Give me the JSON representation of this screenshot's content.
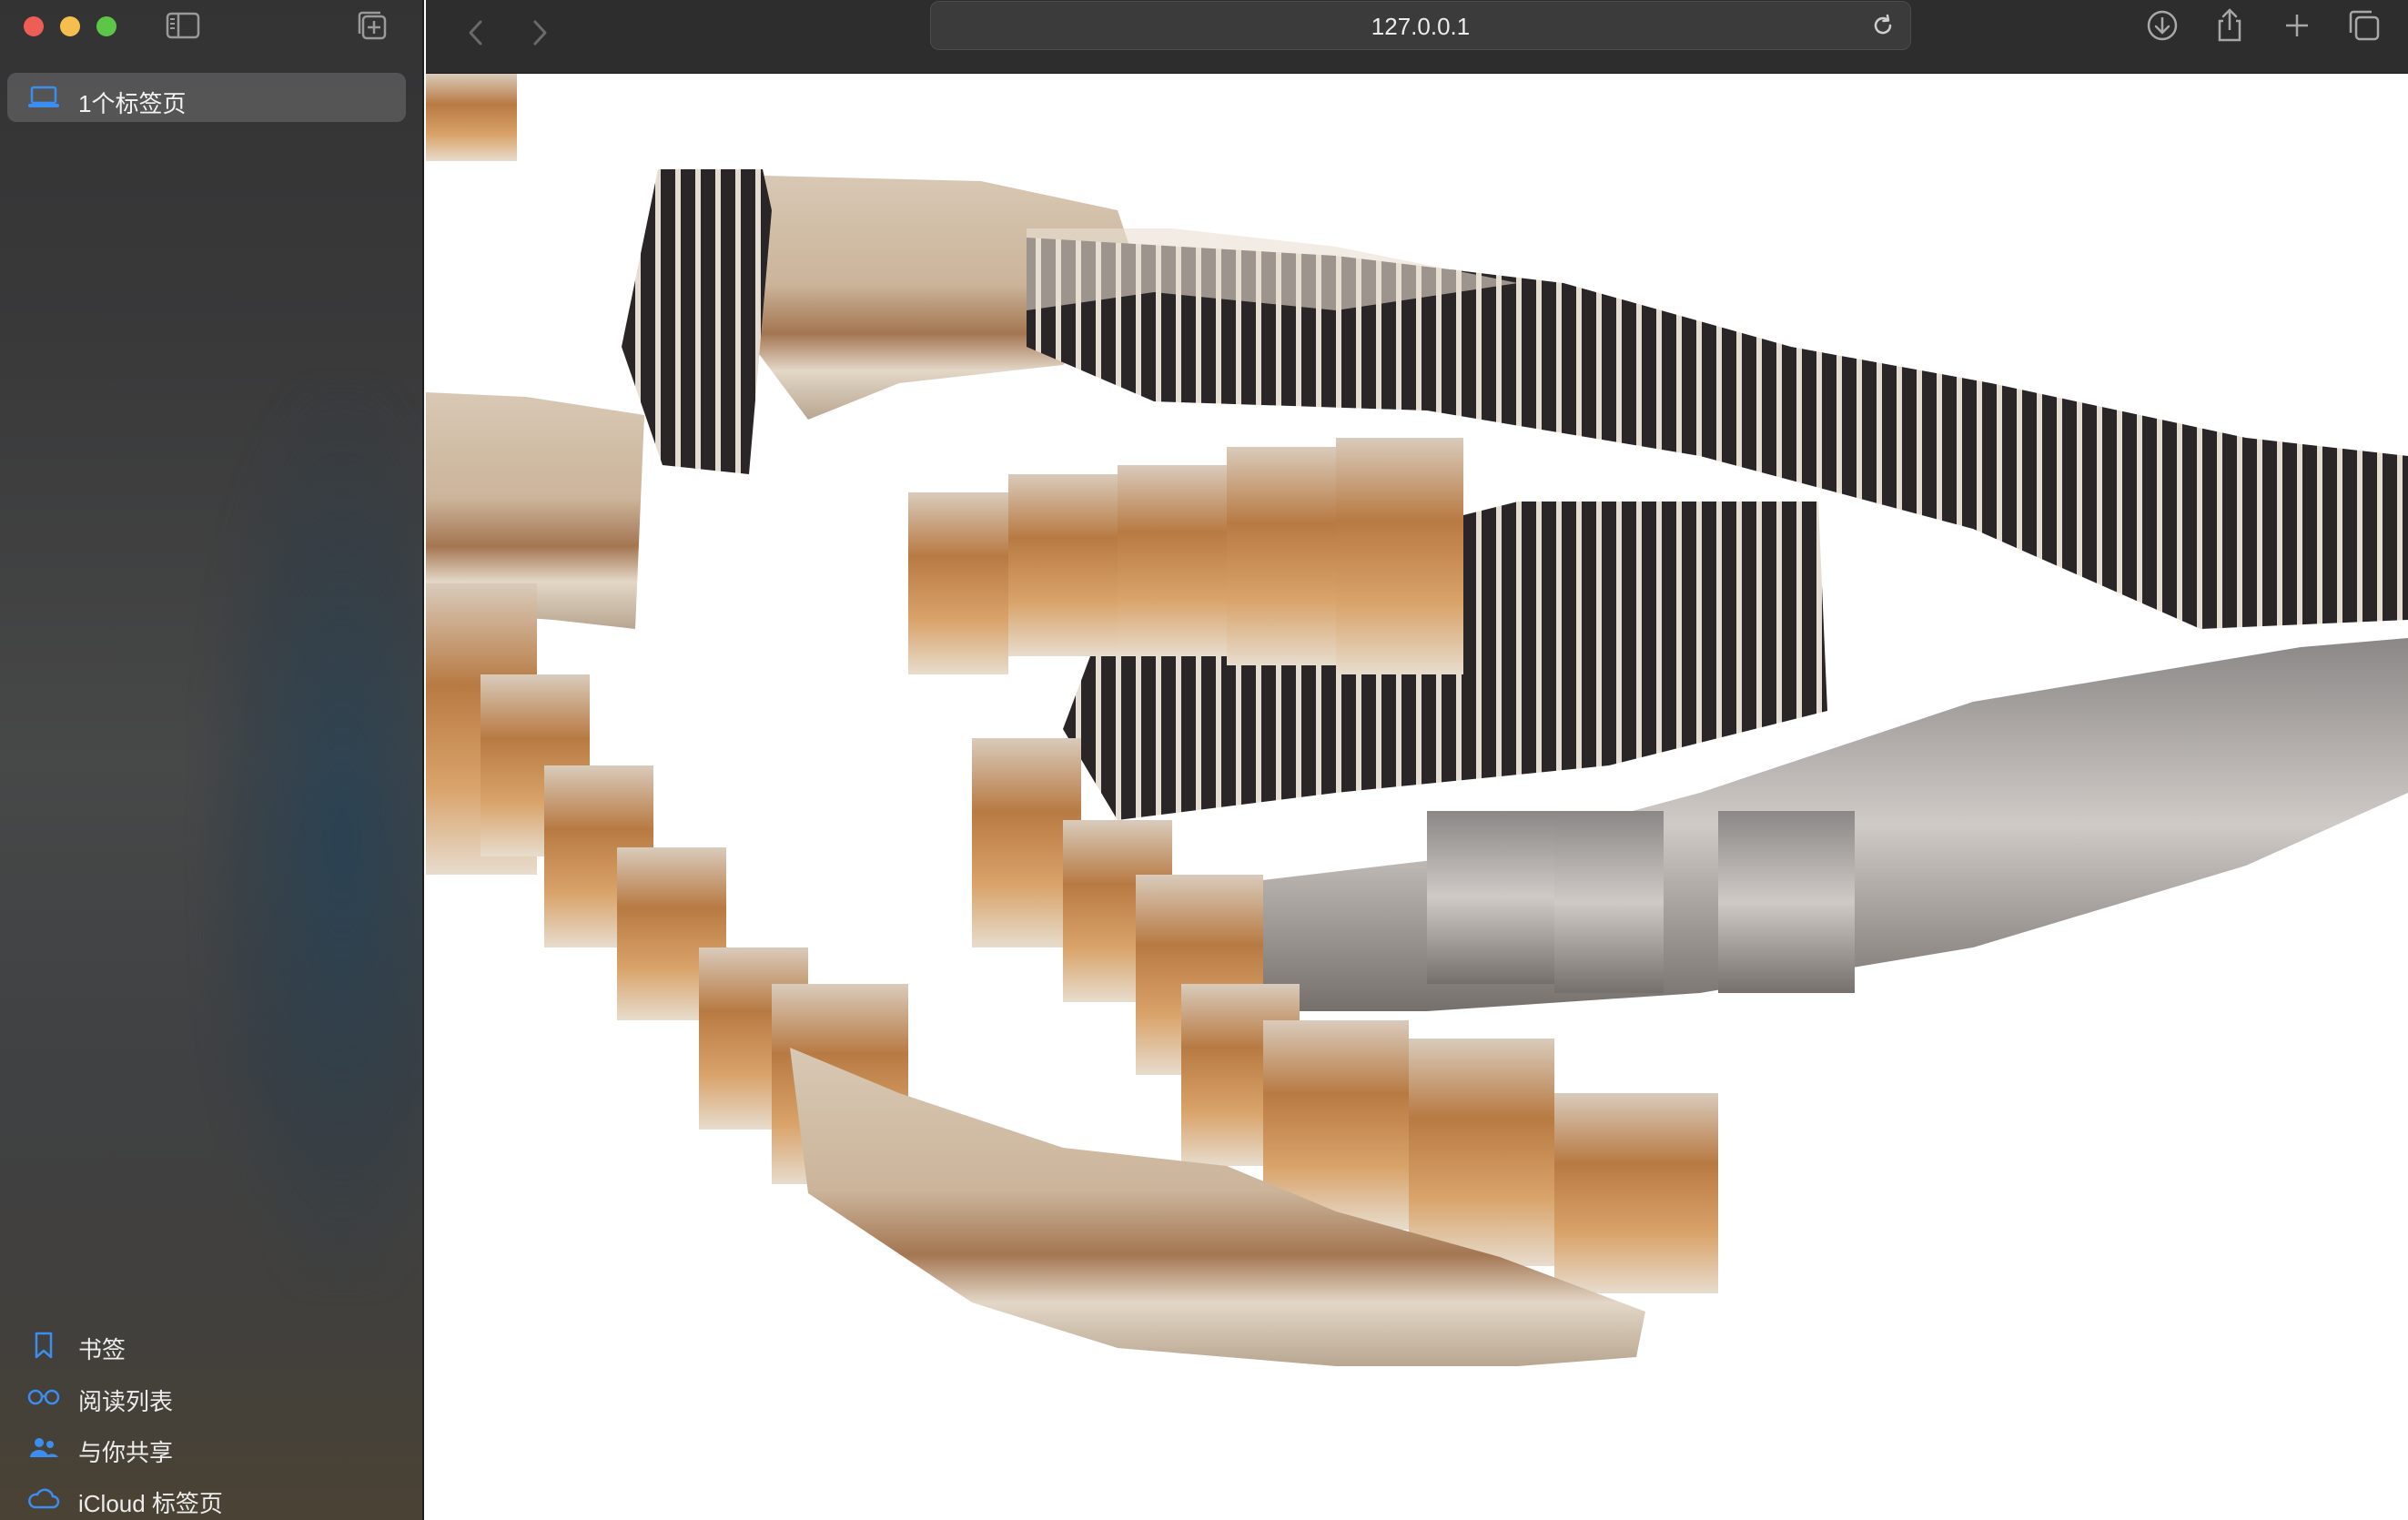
{
  "window": {
    "url": "127.0.0.1"
  },
  "sidebar": {
    "tab_group_label": "1个标签页",
    "items": [
      {
        "label": "书签",
        "icon": "bookmark-icon"
      },
      {
        "label": "阅读列表",
        "icon": "reading-list-icon"
      },
      {
        "label": "与你共享",
        "icon": "shared-with-you-icon"
      },
      {
        "label": "iCloud 标签页",
        "icon": "icloud-icon"
      }
    ]
  },
  "colors": {
    "accent": "#3b8ef0",
    "sidebar_bg": "#3a3a3b",
    "toolbar_bg": "#2d2d2e"
  },
  "content": {
    "description_icons": [
      "puppy-photo",
      "kitten-photo",
      "feather-photo"
    ]
  }
}
